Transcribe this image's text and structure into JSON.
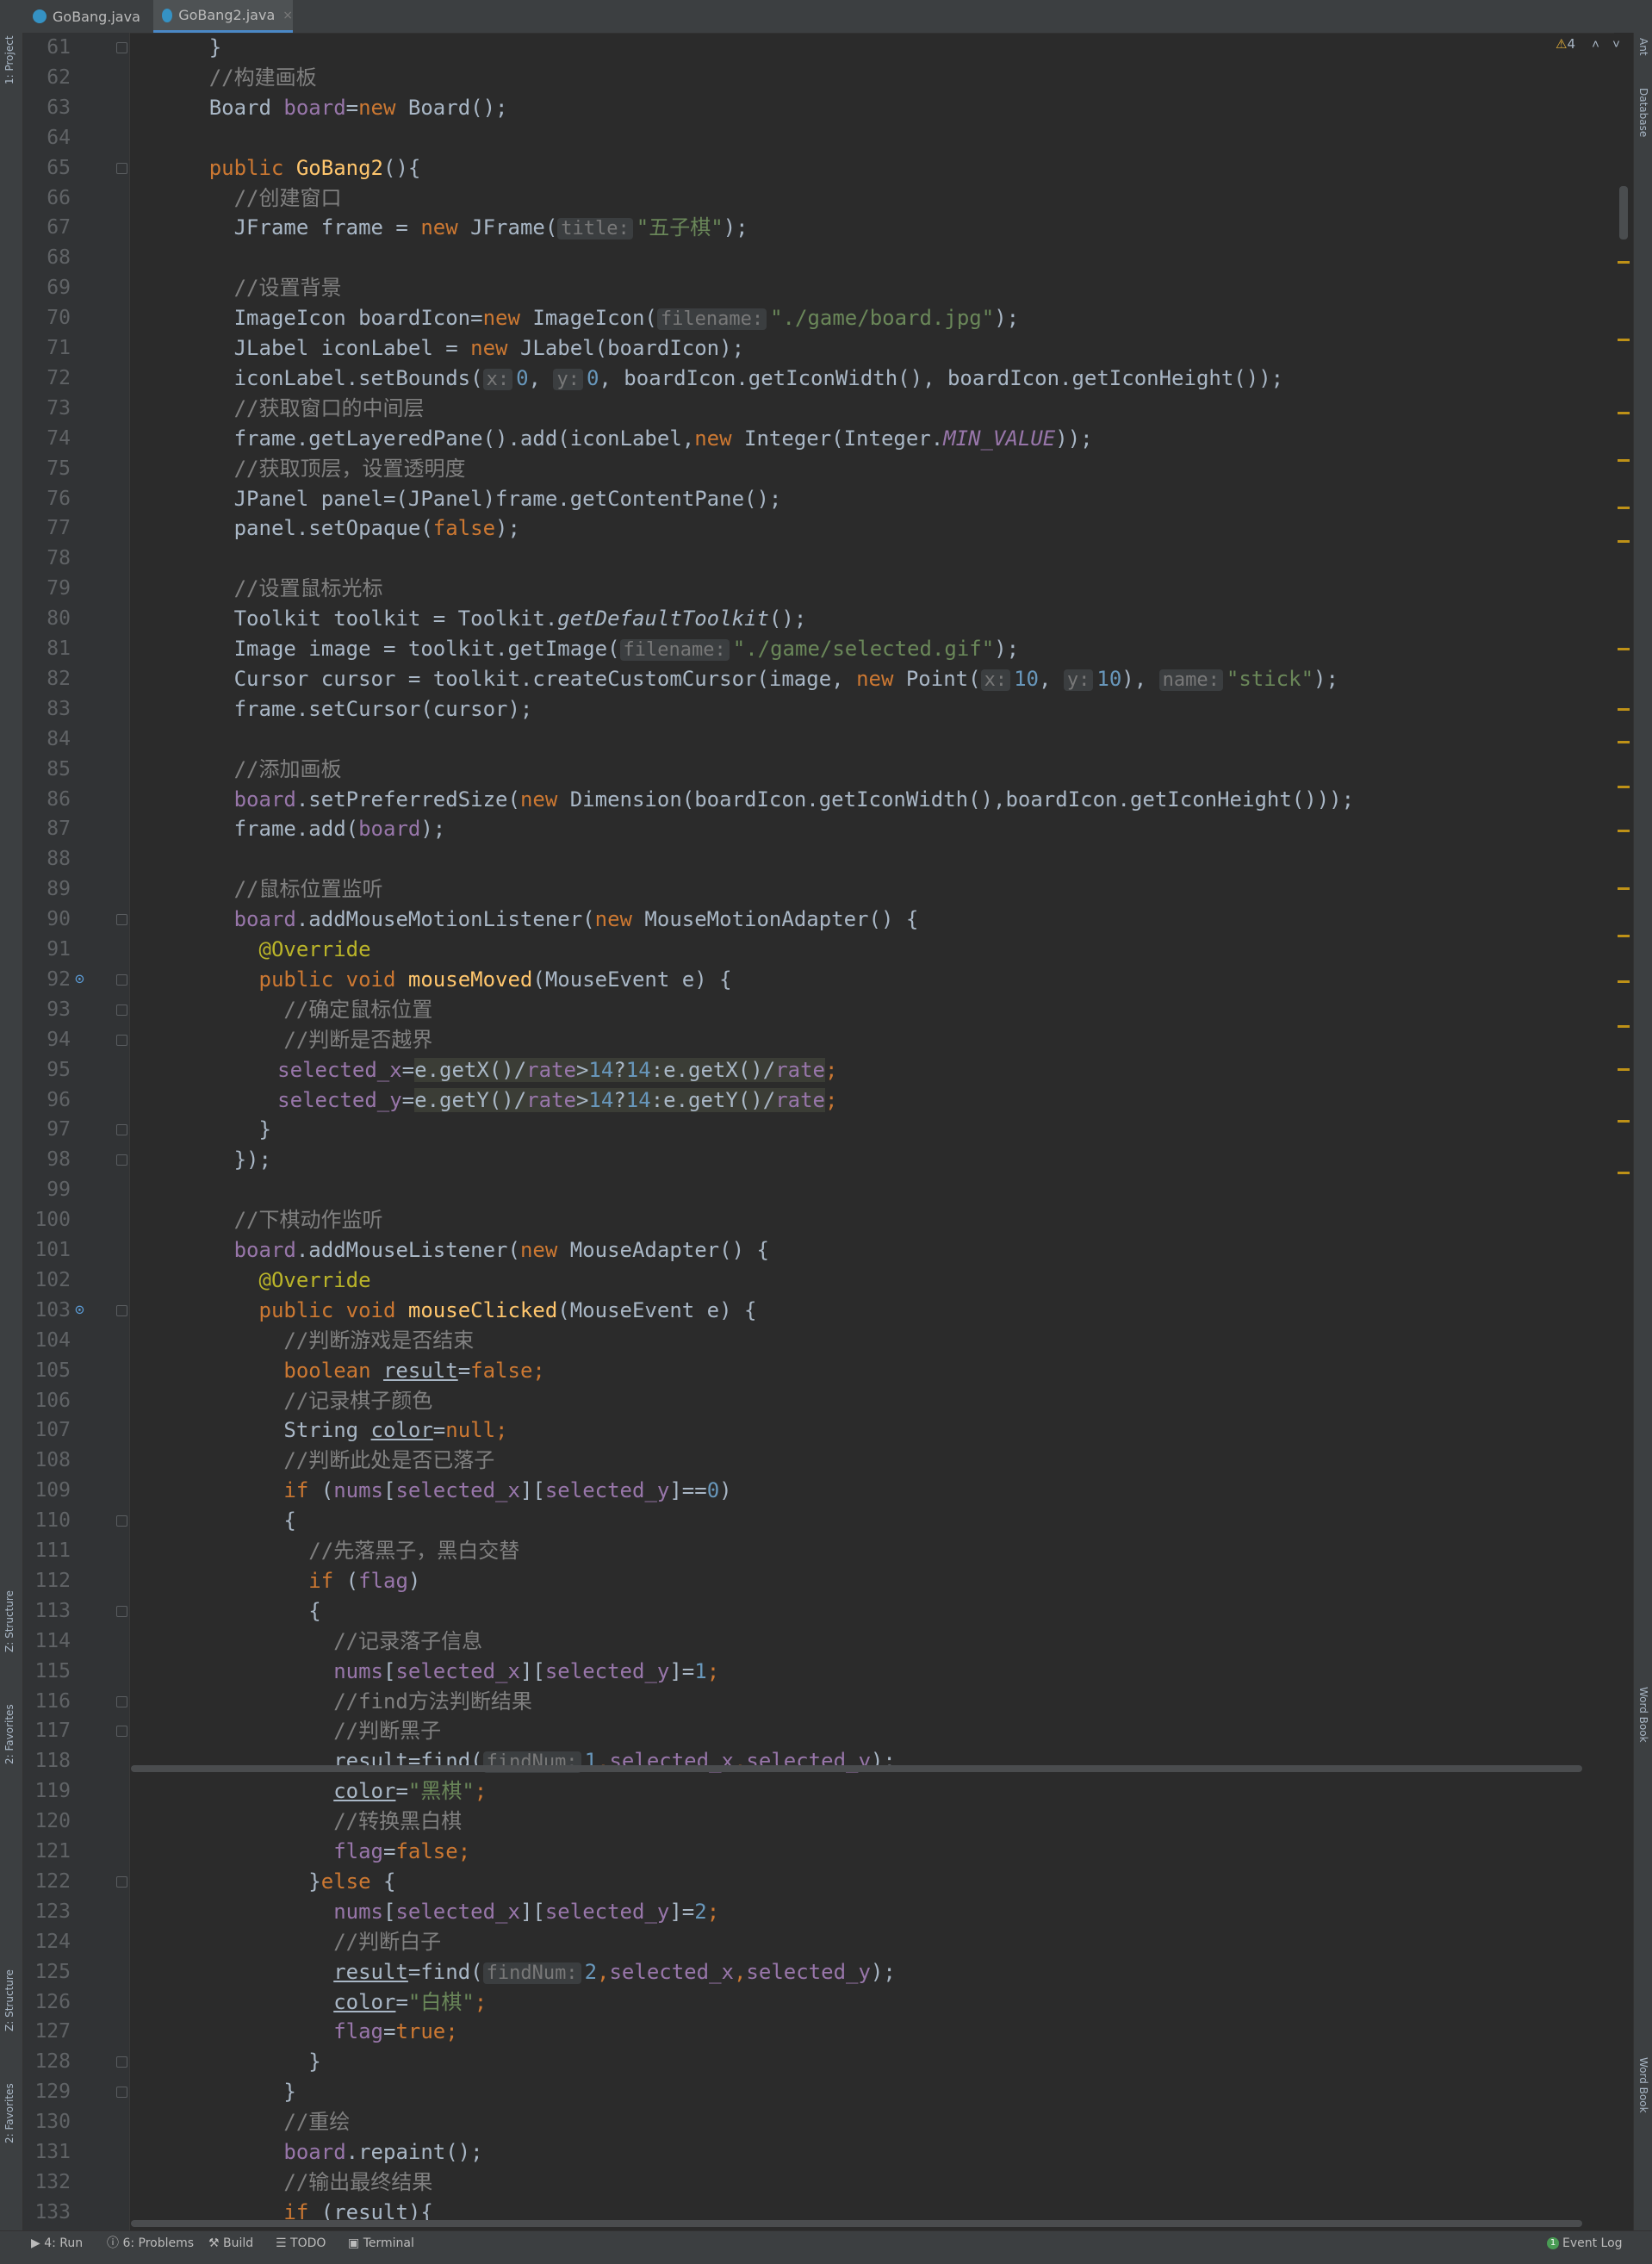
{
  "tabs": [
    {
      "label": "GoBang.java",
      "active": false,
      "icon": "java-class-icon"
    },
    {
      "label": "GoBang2.java",
      "active": true,
      "icon": "java-class-icon"
    }
  ],
  "left_tools": [
    "1: Project",
    "Z: Structure",
    "2: Favorites",
    "Z: Structure",
    "2: Favorites"
  ],
  "right_tools": [
    "Ant",
    "Database",
    "Word Book",
    "Word Book"
  ],
  "inspection": {
    "warnings": "4"
  },
  "gutter": {
    "line_numbers": [
      "61",
      "62",
      "63",
      "64",
      "65",
      "66",
      "67",
      "68",
      "69",
      "70",
      "71",
      "72",
      "73",
      "74",
      "75",
      "76",
      "77",
      "78",
      "79",
      "80",
      "81",
      "82",
      "83",
      "84",
      "85",
      "86",
      "87",
      "88",
      "89",
      "90",
      "91",
      "92",
      "93",
      "94",
      "95",
      "96",
      "97",
      "98",
      "99",
      "100",
      "101",
      "102",
      "103",
      "104",
      "105",
      "106",
      "107",
      "108",
      "109",
      "110",
      "111",
      "112",
      "113",
      "114",
      "115",
      "116",
      "117",
      "118",
      "119",
      "120",
      "121",
      "122",
      "123",
      "124",
      "125",
      "126",
      "127",
      "128",
      "129",
      "130",
      "131",
      "132",
      "133"
    ]
  },
  "code": {
    "l61": "}",
    "l62": "//构建画板",
    "l63": [
      "Board ",
      "board",
      "=",
      "new ",
      "Board();"
    ],
    "l65": [
      "public ",
      "GoBang2",
      "(){"
    ],
    "l66": "//创建窗口",
    "l67": [
      "JFrame frame = ",
      "new ",
      "JFrame(",
      "title:",
      "\"五子棋\"",
      ");"
    ],
    "l69": "//设置背景",
    "l70": [
      "ImageIcon boardIcon=",
      "new ",
      "ImageIcon(",
      "filename:",
      "\"./game/board.jpg\"",
      ");"
    ],
    "l71": [
      "JLabel iconLabel = ",
      "new ",
      "JLabel(boardIcon);"
    ],
    "l72": [
      "iconLabel.setBounds(",
      "x:",
      "0",
      ", ",
      "y:",
      "0",
      ", boardIcon.getIconWidth(), boardIcon.getIconHeight());"
    ],
    "l73": "//获取窗口的中间层",
    "l74": [
      "frame.getLayeredPane().add(iconLabel,",
      "new ",
      "Integer(Integer.",
      "MIN_VALUE",
      "));"
    ],
    "l75": "//获取顶层，设置透明度",
    "l76": [
      "JPanel panel=(JPanel)frame.getContentPane();"
    ],
    "l77": [
      "panel.setOpaque(",
      "false",
      ");"
    ],
    "l79": "//设置鼠标光标",
    "l80": [
      "Toolkit toolkit = Toolkit.",
      "getDefaultToolkit",
      "();"
    ],
    "l81": [
      "Image image = toolkit.getImage(",
      "filename:",
      "\"./game/selected.gif\"",
      ");"
    ],
    "l82": [
      "Cursor cursor = toolkit.createCustomCursor(image, ",
      "new ",
      "Point(",
      "x:",
      "10",
      ", ",
      "y:",
      "10",
      "), ",
      "name:",
      "\"stick\"",
      ");"
    ],
    "l83": [
      "frame.setCursor(cursor);"
    ],
    "l85": "//添加画板",
    "l86": [
      "board",
      ".setPreferredSize(",
      "new ",
      "Dimension(boardIcon.getIconWidth(),boardIcon.getIconHeight()));"
    ],
    "l87": [
      "frame.add(",
      "board",
      ");"
    ],
    "l89": "//鼠标位置监听",
    "l90": [
      "board",
      ".addMouseMotionListener(",
      "new ",
      "MouseMotionAdapter() {"
    ],
    "l91": "@Override",
    "l92": [
      "public void ",
      "mouseMoved",
      "(MouseEvent e) {"
    ],
    "l93": "//确定鼠标位置",
    "l94": "//判断是否越界",
    "l95": [
      "selected_x",
      "=",
      "e.getX()/",
      "rate",
      ">",
      "14",
      "?",
      "14",
      ":e.getX()/",
      "rate",
      ";"
    ],
    "l96": [
      "selected_y",
      "=",
      "e.getY()/",
      "rate",
      ">",
      "14",
      "?",
      "14",
      ":e.getY()/",
      "rate",
      ";"
    ],
    "l97": "}",
    "l98": "});",
    "l100": "//下棋动作监听",
    "l101": [
      "board",
      ".addMouseListener(",
      "new ",
      "MouseAdapter() {"
    ],
    "l102": "@Override",
    "l103": [
      "public void ",
      "mouseClicked",
      "(MouseEvent e) {"
    ],
    "l104": "//判断游戏是否结束",
    "l105": [
      "boolean ",
      "result",
      "=",
      "false",
      ";"
    ],
    "l106": "//记录棋子颜色",
    "l107": [
      "String ",
      "color",
      "=",
      "null",
      ";"
    ],
    "l108": "//判断此处是否已落子",
    "l109": [
      "if ",
      "(",
      "nums",
      "[",
      "selected_x",
      "][",
      "selected_y",
      "]==",
      "0",
      ")"
    ],
    "l110": "{",
    "l111": "//先落黑子，黑白交替",
    "l112": [
      "if ",
      "(",
      "flag",
      ")"
    ],
    "l113": "{",
    "l114": "//记录落子信息",
    "l115": [
      "nums",
      "[",
      "selected_x",
      "][",
      "selected_y",
      "]=",
      "1",
      ";"
    ],
    "l116": "//find方法判断结果",
    "l117": "//判断黑子",
    "l118": [
      "result",
      "=find(",
      "findNum:",
      "1",
      ",",
      "selected_x",
      ",",
      "selected_y",
      ");"
    ],
    "l119": [
      "color",
      "=",
      "\"黑棋\"",
      ";"
    ],
    "l120": "//转换黑白棋",
    "l121": [
      "flag",
      "=",
      "false",
      ";"
    ],
    "l122": [
      "}",
      "else ",
      "{"
    ],
    "l123": [
      "nums",
      "[",
      "selected_x",
      "][",
      "selected_y",
      "]=",
      "2",
      ";"
    ],
    "l124": "//判断白子",
    "l125": [
      "result",
      "=find(",
      "findNum:",
      "2",
      ",",
      "selected_x",
      ",",
      "selected_y",
      ");"
    ],
    "l126": [
      "color",
      "=",
      "\"白棋\"",
      ";"
    ],
    "l127": [
      "flag",
      "=",
      "true",
      ";"
    ],
    "l128": "}",
    "l129": "}",
    "l130": "//重绘",
    "l131": [
      "board",
      ".repaint();"
    ],
    "l132": "//输出最终结果",
    "l133": [
      "if ",
      "(",
      "result",
      "){"
    ]
  },
  "bottom_tools": [
    {
      "label": "4: Run",
      "icon": "run-icon"
    },
    {
      "label": "6: Problems",
      "icon": "problems-icon"
    },
    {
      "label": "Build",
      "icon": "hammer-icon"
    },
    {
      "label": "TODO",
      "icon": "todo-icon"
    },
    {
      "label": "Terminal",
      "icon": "terminal-icon"
    }
  ],
  "event_log": {
    "label": "Event Log",
    "count": "1"
  },
  "colors": {
    "background": "#2b2b2b",
    "keyword": "#cc7832",
    "comment": "#808080",
    "string": "#6a8759",
    "number": "#6897bb",
    "field": "#9876aa",
    "method_decl": "#ffc66d",
    "annotation": "#bbb529",
    "default_text": "#a9b7c6"
  }
}
